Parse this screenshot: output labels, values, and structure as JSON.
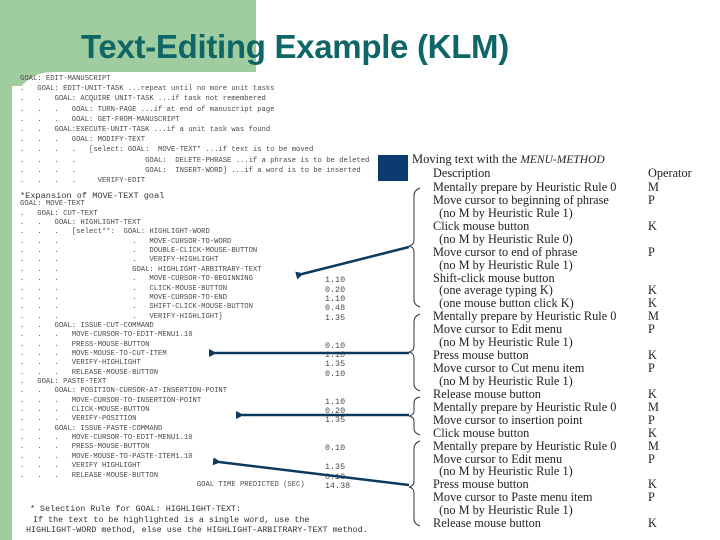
{
  "title": "Text-Editing Example (KLM)",
  "goms_top": [
    "GOAL: EDIT-MANUSCRIPT",
    ".   GOAL: EDIT-UNIT-TASK ...repeat until no more unit tasks",
    ".   .   GOAL: ACQUIRE UNIT-TASK ...if task not remembered",
    ".   .   .   GOAL: TURN-PAGE ...if at end of manuscript page",
    ".   .   .   GOAL: GET-FROM-MANUSCRIPT",
    ".   .   GOAL:EXECUTE-UNIT-TASK ...if a unit task was found",
    ".   .   .   GOAL: MODIFY-TEXT",
    ".   .   .   .   [select: GOAL:  MOVE-TEXT* ...if text is to be moved",
    ".   .   .   .                GOAL:  DELETE-PHRASE ...if a phrase is to be deleted",
    ".   .   .   .                GOAL:  INSERT-WORD] ...if a word is to be inserted",
    ".   .   .   .     VERIFY-EDIT"
  ],
  "goms_expansion": [
    {
      "text": "*Expansion of MOVE-TEXT goal",
      "time": ""
    },
    {
      "text": "GOAL: MOVE-TEXT",
      "time": ""
    },
    {
      "text": ".   GOAL: CUT-TEXT",
      "time": ""
    },
    {
      "text": ".   .   GOAL: HIGHLIGHT-TEXT",
      "time": ""
    },
    {
      "text": ".   .   .   [select**:  GOAL: HIGHLIGHT-WORD",
      "time": ""
    },
    {
      "text": ".   .   .                 .   MOVE-CURSOR-TO-WORD",
      "time": ""
    },
    {
      "text": ".   .   .                 .   DOUBLE-CLICK-MOUSE-BUTTON",
      "time": ""
    },
    {
      "text": ".   .   .                 .   VERIFY-HIGHLIGHT",
      "time": ""
    },
    {
      "text": ".   .   .                 GOAL: HIGHLIGHT-ARBITRARY-TEXT",
      "time": ""
    },
    {
      "text": ".   .   .                 .   MOVE-CURSOR-TO-BEGINNING",
      "time": "1.10"
    },
    {
      "text": ".   .   .                 .   CLICK-MOUSE-BUTTON",
      "time": "0.20"
    },
    {
      "text": ".   .   .                 .   MOVE-CURSOR-TO-END",
      "time": "1.10"
    },
    {
      "text": ".   .   .                 .   SHIFT-CLICK-MOUSE-BUTTON",
      "time": "0.48"
    },
    {
      "text": ".   .   .                 .   VERIFY-HIGHLIGHT]",
      "time": "1.35"
    },
    {
      "text": ".   .   GOAL: ISSUE-CUT-COMMAND",
      "time": ""
    },
    {
      "text": ".   .   .   MOVE-CURSOR-TO-EDIT-MENU1.10",
      "time": ""
    },
    {
      "text": ".   .   .   PRESS-MOUSE-BUTTON",
      "time": "0.10"
    },
    {
      "text": ".   .   .   MOVE-MOUSE-TO-CUT-ITEM",
      "time": "1.10"
    },
    {
      "text": ".   .   .   VERIFY-HIGHLIGHT",
      "time": "1.35"
    },
    {
      "text": ".   .   .   RELEASE-MOUSE-BUTTON",
      "time": "0.10"
    },
    {
      "text": ".   GOAL: PASTE-TEXT",
      "time": ""
    },
    {
      "text": ".   .   GOAL: POSITION-CURSOR-AT-INSERTION-POINT",
      "time": ""
    },
    {
      "text": ".   .   .   MOVE-CURSOR-TO-INSERTION-POINT",
      "time": "1.10"
    },
    {
      "text": ".   .   .   CLICK-MOUSE-BUTTON",
      "time": "0.20"
    },
    {
      "text": ".   .   .   VERIFY-POSITION",
      "time": "1.35"
    },
    {
      "text": ".   .   GOAL: ISSUE-PASTE-COMMAND",
      "time": ""
    },
    {
      "text": ".   .   .   MOVE-CURSOR-TO-EDIT-MENU1.10",
      "time": ""
    },
    {
      "text": ".   .   .   PRESS-MOUSE-BUTTON",
      "time": "0.10"
    },
    {
      "text": ".   .   .   MOVE-MOUSE-TO-PASTE-ITEM1.10",
      "time": ""
    },
    {
      "text": ".   .   .   VERIFY HIGHLIGHT",
      "time": "1.35"
    },
    {
      "text": ".   .   .   RELEASE-MOUSE-BUTTON",
      "time": "0.10"
    },
    {
      "text": "                                         GOAL TIME PREDICTED (SEC)",
      "time": "14.38"
    }
  ],
  "selection_rule": [
    "* Selection Rule for GOAL: HIGHLIGHT-TEXT:",
    " If the text to be highlighted is a single word, use the",
    "HIGHLIGHT-WORD method, else use the HIGHLIGHT-ARBITRARY-TEXT method."
  ],
  "klm": {
    "title_prefix": "Moving text with the ",
    "title_method": "MENU-METHOD",
    "header_description": "Description",
    "header_operator": "Operator",
    "rows": [
      {
        "desc": "Mentally prepare by Heuristic Rule 0",
        "op": "M"
      },
      {
        "desc": "Move cursor to beginning of phrase",
        "op": "P"
      },
      {
        "desc": "  (no M by Heuristic Rule 1)",
        "op": ""
      },
      {
        "desc": "Click mouse button",
        "op": "K"
      },
      {
        "desc": "  (no M by Heuristic Rule 0)",
        "op": ""
      },
      {
        "desc": "Move cursor to end of phrase",
        "op": "P"
      },
      {
        "desc": "  (no M by Heuristic Rule 1)",
        "op": ""
      },
      {
        "desc": "Shift-click mouse button",
        "op": ""
      },
      {
        "desc": "  (one average typing K)",
        "op": "K"
      },
      {
        "desc": "  (one mouse button click K)",
        "op": "K"
      },
      {
        "desc": "Mentally prepare by Heuristic Rule 0",
        "op": "M"
      },
      {
        "desc": "Move cursor to Edit menu",
        "op": "P"
      },
      {
        "desc": "  (no M by Heuristic Rule 1)",
        "op": ""
      },
      {
        "desc": "Press mouse button",
        "op": "K"
      },
      {
        "desc": "Move cursor to Cut menu item",
        "op": "P"
      },
      {
        "desc": "  (no M by Heuristic Rule 1)",
        "op": ""
      },
      {
        "desc": "Release mouse button",
        "op": "K"
      },
      {
        "desc": "Mentally prepare by Heuristic Rule 0",
        "op": "M"
      },
      {
        "desc": "Move cursor to insertion point",
        "op": "P"
      },
      {
        "desc": "Click mouse button",
        "op": "K"
      },
      {
        "desc": "Mentally prepare by Heuristic Rule 0",
        "op": "M"
      },
      {
        "desc": "Move cursor to Edit menu",
        "op": "P"
      },
      {
        "desc": "  (no M by Heuristic Rule 1)",
        "op": ""
      },
      {
        "desc": "Press mouse button",
        "op": "K"
      },
      {
        "desc": "Move cursor to Paste menu item",
        "op": "P"
      },
      {
        "desc": "  (no M by Heuristic Rule 1)",
        "op": ""
      },
      {
        "desc": "Release mouse button",
        "op": "K"
      }
    ]
  },
  "colors": {
    "title": "#0f6666",
    "green_accent": "#9fcd9f",
    "arrow": "#0b3a5e",
    "blue_square": "#0b3a6e"
  }
}
